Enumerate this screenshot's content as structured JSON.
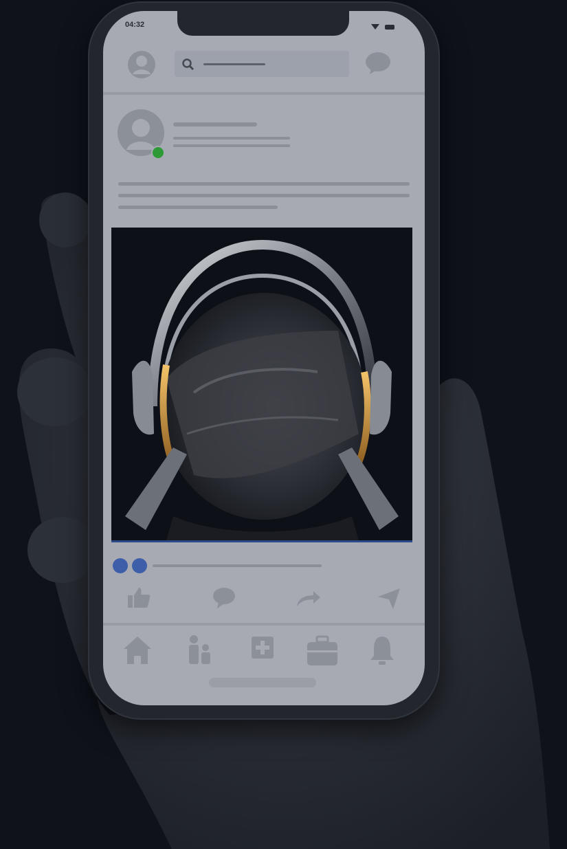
{
  "status_bar": {
    "time": "04:32"
  },
  "colors": {
    "background": "#0f121b",
    "screen": "#a7aab3",
    "icon": "#8c9099",
    "online": "#2e9a35",
    "reaction": "#3d5ea8"
  },
  "icons": {
    "top_bar": [
      "profile-avatar-icon",
      "search-icon",
      "messenger-icon"
    ],
    "actions": [
      "like-icon",
      "comment-icon",
      "share-icon",
      "send-icon"
    ],
    "bottom_nav": [
      "home-icon",
      "friends-icon",
      "add-icon",
      "marketplace-icon",
      "notifications-icon"
    ]
  }
}
